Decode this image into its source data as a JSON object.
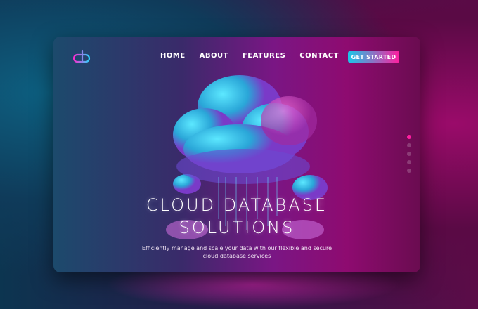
{
  "brand": {
    "logo_text": "cb"
  },
  "nav": {
    "items": [
      {
        "label": "HOME"
      },
      {
        "label": "ABOUT"
      },
      {
        "label": "FEATURES"
      },
      {
        "label": "CONTACT"
      }
    ],
    "cta_label": "GET STARTED"
  },
  "hero": {
    "title_line1": "CLOUD DATABASE",
    "title_line2": "SOLUTIONS",
    "subtitle_line1": "Efficiently manage and scale your data with our flexible and secure",
    "subtitle_line2": "cloud database services"
  },
  "slider": {
    "total": 5,
    "active_index": 0
  },
  "colors": {
    "accent_cyan": "#18c8e8",
    "accent_pink": "#ff1ea0"
  }
}
